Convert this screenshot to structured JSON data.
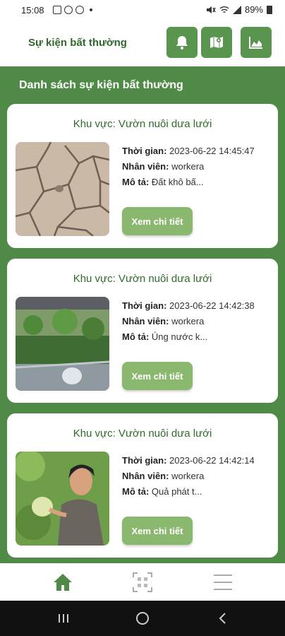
{
  "status_bar": {
    "time": "15:08",
    "battery": "89%"
  },
  "header": {
    "title": "Sự kiện bất thường"
  },
  "section": {
    "title": "Danh sách sự kiện bất thường"
  },
  "labels": {
    "time": "Thời gian:",
    "staff": "Nhân viên:",
    "desc": "Mô tả:"
  },
  "events": [
    {
      "area": "Khu vực: Vườn nuôi dưa lưới",
      "time": "2023-06-22 14:45:47",
      "staff": "workera",
      "desc": "Đất khô bấ...",
      "button": "Xem chi tiết",
      "image": "cracked-dry-soil"
    },
    {
      "area": "Khu vực: Vườn nuôi dưa lưới",
      "time": "2023-06-22 14:42:38",
      "staff": "workera",
      "desc": "Úng nước k...",
      "button": "Xem chi tiết",
      "image": "waterlogged-garden"
    },
    {
      "area": "Khu vực: Vườn nuôi dưa lưới",
      "time": "2023-06-22 14:42:14",
      "staff": "workera",
      "desc": "Quả phát t...",
      "button": "Xem chi tiết",
      "image": "woman-with-melon"
    }
  ],
  "nav": {
    "items": [
      {
        "name": "home",
        "icon": "home-icon",
        "active": true
      },
      {
        "name": "qr",
        "icon": "qr-scan-icon",
        "active": false
      },
      {
        "name": "menu",
        "icon": "hamburger-menu-icon",
        "active": false
      }
    ]
  },
  "colors": {
    "primary": "#4f8a46",
    "accent": "#8bb86f",
    "title": "#2f6a2a"
  }
}
